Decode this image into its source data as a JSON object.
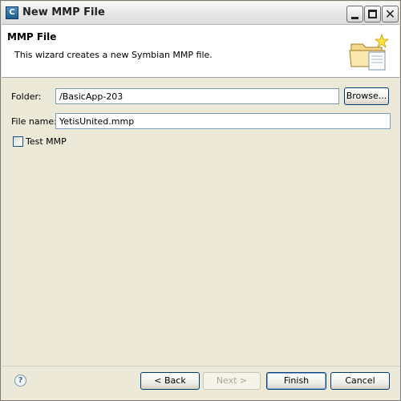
{
  "window": {
    "title": "New MMP File",
    "app_icon_letter": "C"
  },
  "banner": {
    "title": "MMP File",
    "description": "This wizard creates a new Symbian MMP file."
  },
  "form": {
    "folder_label": "Folder:",
    "folder_value": "/BasicApp-203",
    "browse_label": "Browse...",
    "filename_label": "File name:",
    "filename_value": "YetisUnited.mmp",
    "test_mmp_label": "Test MMP",
    "test_mmp_checked": false
  },
  "buttons": {
    "back": "< Back",
    "next": "Next >",
    "finish": "Finish",
    "cancel": "Cancel"
  },
  "help_icon": "help-icon"
}
